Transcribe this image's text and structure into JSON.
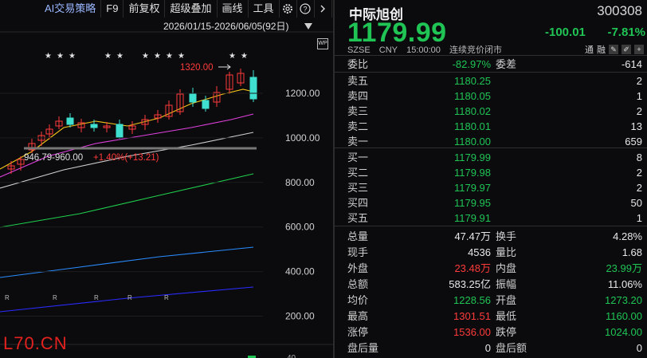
{
  "toolbar": {
    "ai_label": "AI交易策略",
    "f9_label": "F9",
    "restore_label": "前复权",
    "overlay_label": "超级叠加",
    "draw_label": "画线",
    "tools_label": "工具"
  },
  "chart": {
    "date_range": "2026/01/15-2026/06/05(92日)",
    "y_ticks": [
      "1200.00",
      "1000.00",
      "800.00",
      "600.00",
      "400.00",
      "200.00"
    ],
    "high_annotation": "1320.00",
    "cost_annotation": "946.79-960.00",
    "cost_change": "+1.40%(+13.21)",
    "watermark": "L70.CN",
    "star_marker": "★",
    "r_marker": "R",
    "partial_label": "40"
  },
  "stock": {
    "name": "中际旭创",
    "code": "300308",
    "price": "1179.99",
    "change": "-100.01",
    "change_pct": "-7.81%",
    "exchange": "SZSE",
    "currency": "CNY",
    "time": "15:00:00",
    "status": "连续竞价闭市",
    "tong": "通",
    "rong": "融"
  },
  "commission": {
    "ratio_label": "委比",
    "ratio_value": "-82.97%",
    "diff_label": "委差",
    "diff_value": "-614"
  },
  "asks": [
    {
      "label": "卖五",
      "price": "1180.25",
      "qty": "2"
    },
    {
      "label": "卖四",
      "price": "1180.05",
      "qty": "1"
    },
    {
      "label": "卖三",
      "price": "1180.02",
      "qty": "2"
    },
    {
      "label": "卖二",
      "price": "1180.01",
      "qty": "13"
    },
    {
      "label": "卖一",
      "price": "1180.00",
      "qty": "659"
    }
  ],
  "bids": [
    {
      "label": "买一",
      "price": "1179.99",
      "qty": "8"
    },
    {
      "label": "买二",
      "price": "1179.98",
      "qty": "2"
    },
    {
      "label": "买三",
      "price": "1179.97",
      "qty": "2"
    },
    {
      "label": "买四",
      "price": "1179.95",
      "qty": "50"
    },
    {
      "label": "买五",
      "price": "1179.91",
      "qty": "1"
    }
  ],
  "stats": [
    {
      "l1": "总量",
      "v1": "47.47万",
      "c1": "w",
      "l2": "换手",
      "v2": "4.28%",
      "c2": "w"
    },
    {
      "l1": "现手",
      "v1": "4536",
      "c1": "w",
      "l2": "量比",
      "v2": "1.68",
      "c2": "w"
    },
    {
      "l1": "外盘",
      "v1": "23.48万",
      "c1": "r",
      "l2": "内盘",
      "v2": "23.99万",
      "c2": "g"
    },
    {
      "l1": "总额",
      "v1": "583.25亿",
      "c1": "w",
      "l2": "振幅",
      "v2": "11.06%",
      "c2": "w"
    },
    {
      "l1": "均价",
      "v1": "1228.56",
      "c1": "g",
      "l2": "开盘",
      "v2": "1273.20",
      "c2": "g"
    },
    {
      "l1": "最高",
      "v1": "1301.51",
      "c1": "r",
      "l2": "最低",
      "v2": "1160.00",
      "c2": "g"
    },
    {
      "l1": "涨停",
      "v1": "1536.00",
      "c1": "r",
      "l2": "跌停",
      "v2": "1024.00",
      "c2": "g"
    },
    {
      "l1": "盘后量",
      "v1": "0",
      "c1": "w",
      "l2": "盘后额",
      "v2": "0",
      "c2": "w"
    }
  ],
  "colors": {
    "up": "#ff3b3b",
    "down": "#20c455",
    "bg": "#0b0b0d"
  }
}
